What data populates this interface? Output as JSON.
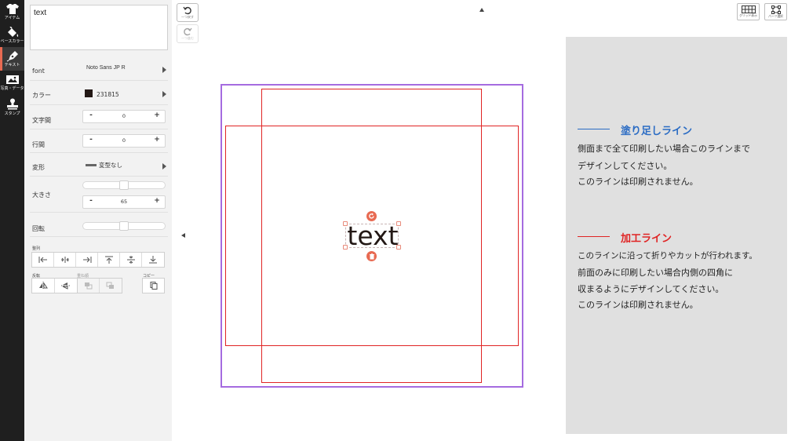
{
  "rail": {
    "items": [
      {
        "label": "アイテム",
        "icon": "tshirt-icon"
      },
      {
        "label": "ベースカラー",
        "icon": "paint-bucket-icon"
      },
      {
        "label": "テキスト",
        "icon": "pen-icon",
        "active": true
      },
      {
        "label": "写真・データ",
        "icon": "image-icon"
      },
      {
        "label": "スタンプ",
        "icon": "stamp-icon"
      }
    ]
  },
  "panel": {
    "text_value": "text",
    "font": {
      "label": "font",
      "value": "Noto Sans JP R"
    },
    "color": {
      "label": "カラー",
      "value": "231815",
      "swatch": "#231815"
    },
    "letter_spacing": {
      "label": "文字間",
      "value": "0"
    },
    "line_spacing": {
      "label": "行間",
      "value": "0"
    },
    "transform": {
      "label": "変形",
      "value": "変型なし"
    },
    "size": {
      "label": "大きさ",
      "value": "65",
      "slider_fraction": 0.5
    },
    "rotation": {
      "label": "回転",
      "slider_fraction": 0.5
    },
    "align_label": "整列",
    "flip_label": "反転",
    "order_label": "重ね順",
    "copy_label": "コピー"
  },
  "toolbar": {
    "undo_label": "一つ戻す",
    "redo_label": "一つ進む",
    "grid_label": "グリッド表示",
    "parts_label": "パーツ選択"
  },
  "canvas": {
    "object_text": "text",
    "text_color": "#231815"
  },
  "legend": {
    "bleed": {
      "title": "塗り足しライン",
      "color": "#2b6cc4",
      "lines": [
        "側面まで全て印刷したい場合このラインまで",
        "デザインしてください。",
        "このラインは印刷されません。"
      ]
    },
    "process": {
      "title": "加工ライン",
      "color": "#e02424",
      "lines": [
        "このラインに沿って折りやカットが行われます。",
        "前面のみに印刷したい場合内側の四角に",
        "収まるようにデザインしてください。",
        "このラインは印刷されません。"
      ]
    }
  },
  "colors": {
    "accent": "#e86a52",
    "bleed_line": "#a56be0",
    "process_line": "#e02424",
    "rail_bg": "#1f1f1f",
    "legend_bg": "#e0e0e0"
  }
}
